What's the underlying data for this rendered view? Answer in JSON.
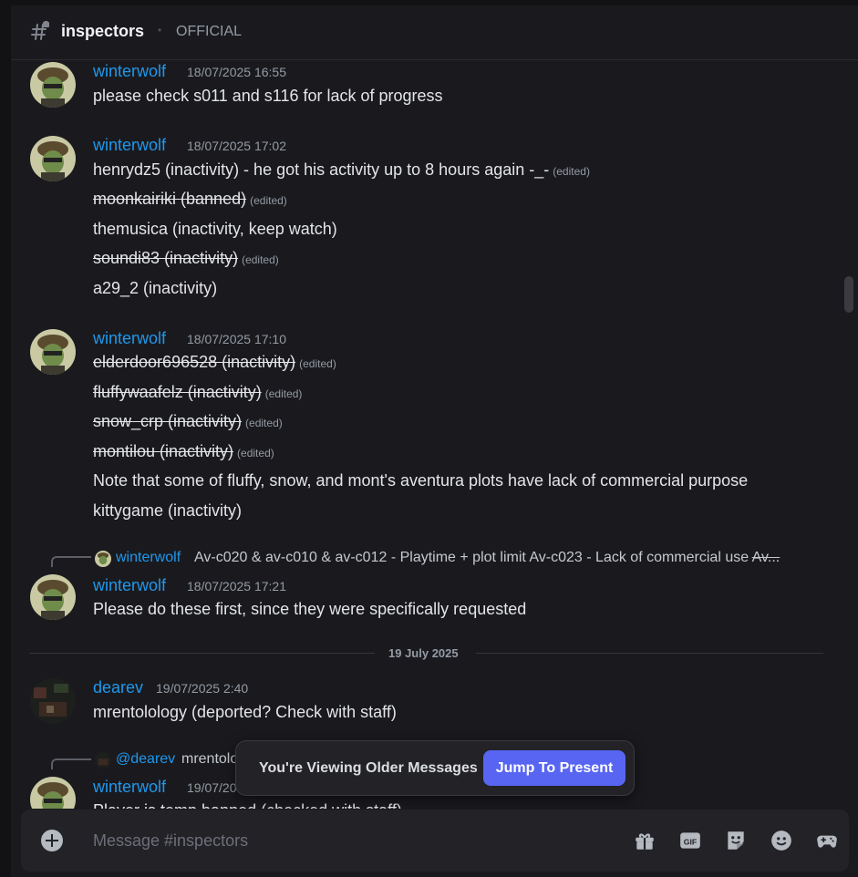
{
  "header": {
    "channel_name": "inspectors",
    "dot": "•",
    "topic": "OFFICIAL"
  },
  "messages": [
    {
      "author": "winterwolf",
      "timestamp": "18/07/2025 16:55",
      "lines": [
        "please check s011 and s116 for lack of progress"
      ]
    },
    {
      "author": "winterwolf",
      "timestamp": "18/07/2025 17:02",
      "lines": [
        "henrydz5 (inactivity) - he got his activity up to 8 hours again -_-",
        "moonkairiki (banned)",
        "themusica (inactivity, keep watch)",
        "soundi83 (inactivity)",
        "a29_2 (inactivity)"
      ]
    },
    {
      "author": "winterwolf",
      "timestamp": "18/07/2025 17:10",
      "lines": [
        "elderdoor696528 (inactivity)",
        "fluffywaafelz (inactivity)",
        "snow_crp (inactivity)",
        "montilou (inactivity)",
        "Note that some of fluffy, snow, and mont's aventura plots have lack of commercial purpose",
        "kittygame (inactivity)"
      ]
    },
    {
      "reply_author": "winterwolf",
      "reply_text": "Av-c020 & av-c010 & av-c012 - Playtime + plot limit Av-c023 - Lack of commercial use",
      "reply_text_strike": "Av...",
      "author": "winterwolf",
      "timestamp": "18/07/2025 17:21",
      "lines": [
        "Please do these first, since they were specifically requested"
      ]
    },
    {
      "author": "dearev",
      "timestamp": "19/07/2025 2:40",
      "lines": [
        "mrentolology (deported? Check with staff)"
      ]
    },
    {
      "reply_author": "@dearev",
      "reply_text": "mrentolo",
      "author": "winterwolf",
      "timestamp": "19/07/20",
      "lines": [
        "Player is temp banned (checked with staff)"
      ]
    }
  ],
  "edited_label": "(edited)",
  "date_divider": "19 July 2025",
  "toast": {
    "text": "You're Viewing Older Messages",
    "button": "Jump To Present"
  },
  "composer": {
    "placeholder": "Message #inspectors"
  },
  "icons": {
    "gift": "gift-icon",
    "gif": "GIF",
    "sticker": "sticker-icon",
    "emoji": "emoji-icon",
    "activities": "gamepad-icon"
  },
  "colors": {
    "accent": "#5865f2",
    "author": "#1e98ee"
  }
}
